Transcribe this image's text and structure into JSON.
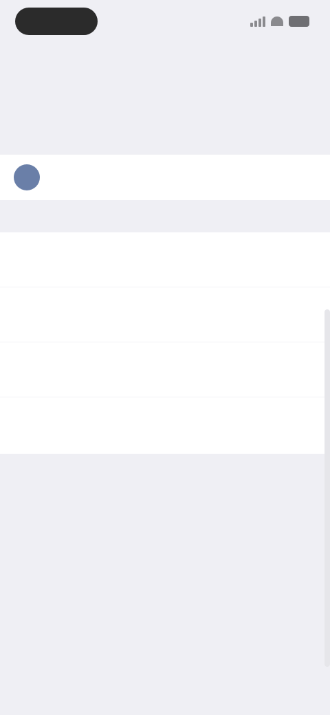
{
  "nav": {
    "title": ""
  },
  "section": {
    "header": ""
  },
  "account": {
    "name": ""
  },
  "settings": {
    "items": [
      {
        "label": ""
      },
      {
        "label": ""
      },
      {
        "label": ""
      },
      {
        "label": ""
      }
    ]
  },
  "footer": {
    "logo_mark": "",
    "logo_word": "",
    "version": "",
    "links": [
      {
        "label": ""
      },
      {
        "label": ""
      },
      {
        "label": ""
      }
    ]
  },
  "colors": {
    "background": "#efeff4",
    "card": "#ffffff",
    "link": "#4a6bd6",
    "avatar": "#6a7fa8"
  },
  "icons": {
    "avatar": "user-avatar-icon",
    "signal": "signal-icon",
    "wifi": "wifi-icon",
    "battery": "battery-icon"
  }
}
